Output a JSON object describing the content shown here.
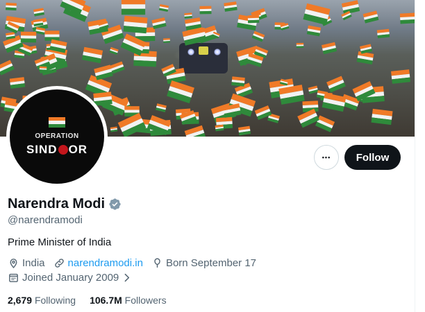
{
  "profile": {
    "name": "Narendra Modi",
    "handle": "@narendramodi",
    "bio": "Prime Minister of India",
    "location": "India",
    "website": "narendramodi.in",
    "birthday": "Born September 17",
    "joined": "Joined January 2009",
    "verified": true
  },
  "avatar": {
    "line1": "OPERATION",
    "line2_a": "SIND",
    "line2_b": "OR"
  },
  "actions": {
    "more_label": "•••",
    "follow_label": "Follow"
  },
  "stats": {
    "following_count": "2,679",
    "following_label": "Following",
    "followers_count": "106.7M",
    "followers_label": "Followers"
  },
  "colors": {
    "accent": "#1d9bf0",
    "follow_bg": "#0f1419",
    "secondary_text": "#536471",
    "saffron": "#f07a27",
    "green": "#2f8a3b"
  },
  "icons": [
    "location-icon",
    "link-icon",
    "birthday-icon",
    "calendar-icon",
    "chevron-right-icon",
    "verified-icon"
  ]
}
